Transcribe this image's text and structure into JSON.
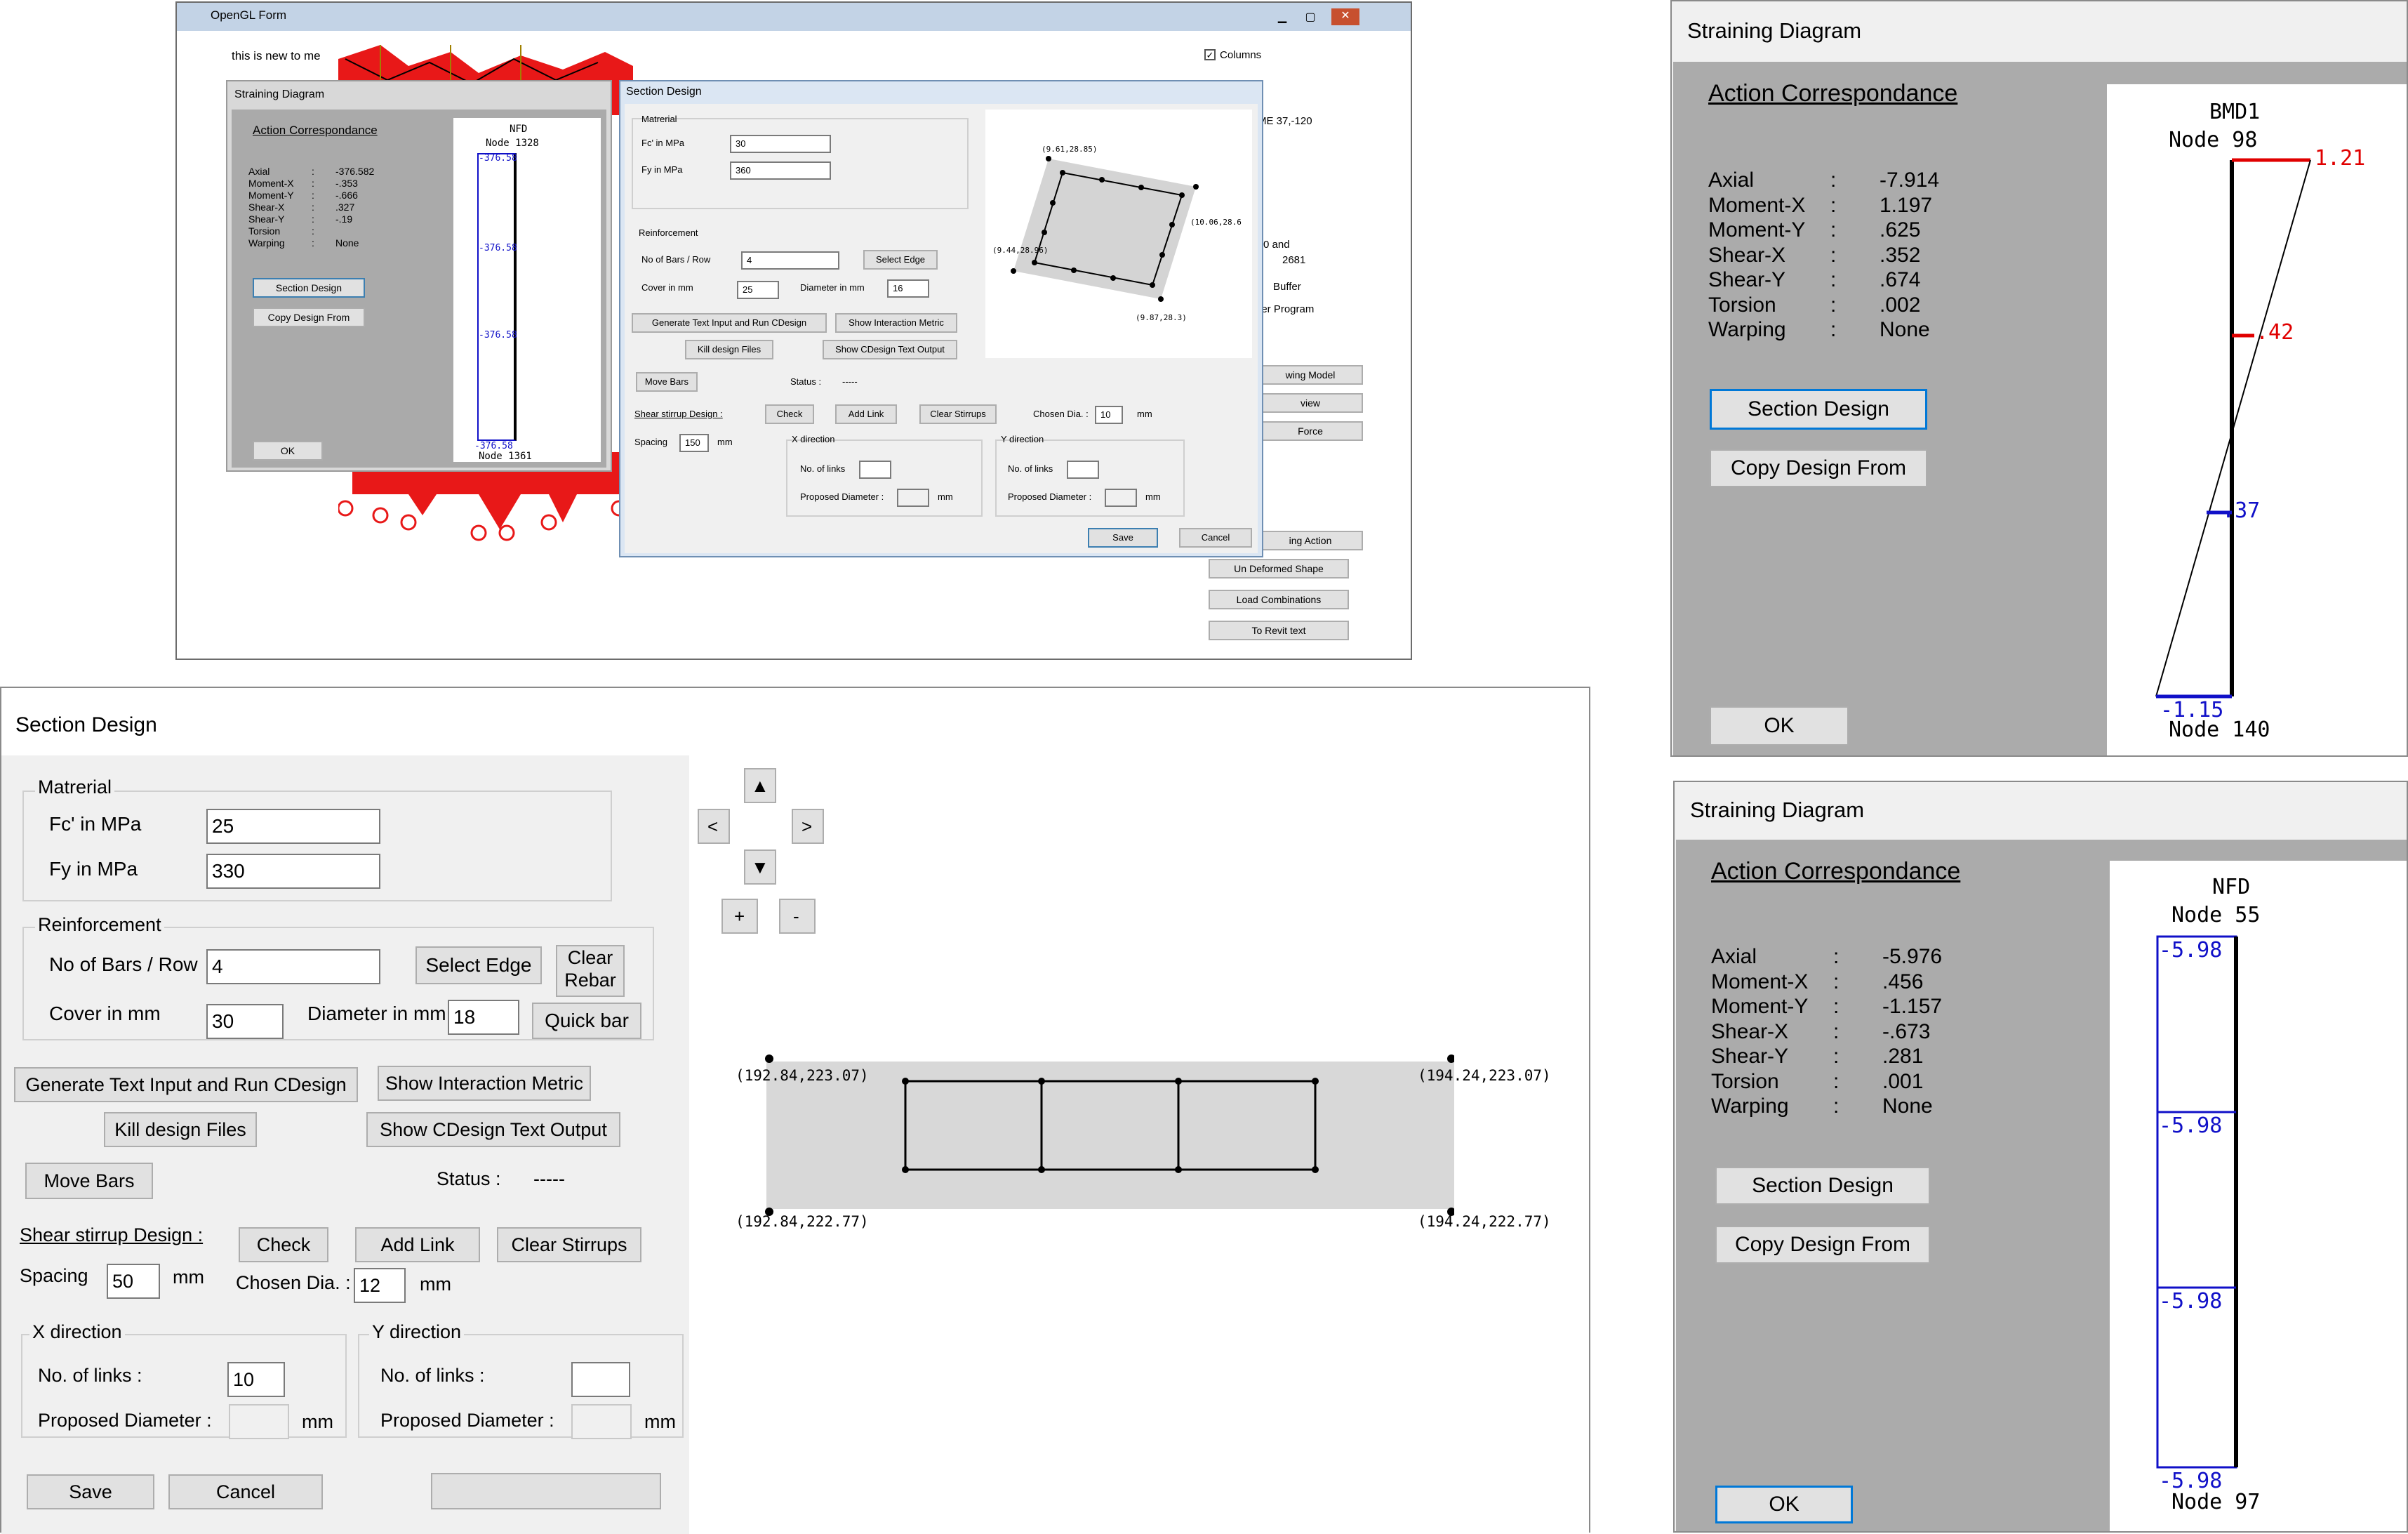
{
  "colors": {
    "dialog_bg": "#f0f0f0",
    "straining_bg": "#ababab",
    "moment_red": "#e00000",
    "value_blue": "#1010c8",
    "accent_blue": "#0078d7",
    "red_mesh": "#e81818"
  },
  "thumbnail": {
    "window_title": "OpenGL Form",
    "caption": "this is new to me",
    "min_icon": "minimize-icon",
    "max_icon": "maximize-icon",
    "close_icon": "close-icon",
    "columns_label": "Columns",
    "right_texts": [
      "ME 37,-120",
      "2681",
      "0 and",
      "Buffer",
      "ler Program"
    ],
    "right_buttons": [
      "wing Model",
      "view",
      "Force",
      "ing Action",
      "Un Deformed Shape",
      "Load Combinations",
      "To Revit text"
    ],
    "straining": {
      "title": "Straining Diagram",
      "action_title": "Action Correspondance",
      "rows": [
        {
          "k": "Axial",
          "v": "-376.582"
        },
        {
          "k": "Moment-X",
          "v": "-.353"
        },
        {
          "k": "Moment-Y",
          "v": "-.666"
        },
        {
          "k": "Shear-X",
          "v": ".327"
        },
        {
          "k": "Shear-Y",
          "v": "-.19"
        },
        {
          "k": "Torsion",
          "v": ""
        },
        {
          "k": "Warping",
          "v": "None"
        }
      ],
      "colon": ":",
      "section_design": "Section Design",
      "copy_design": "Copy Design From",
      "ok": "OK",
      "diagram_title": "NFD",
      "node_top": "Node 1328",
      "node_bottom": "Node 1361",
      "values": [
        "-376.58",
        "-376.58",
        "-376.58",
        "-376.58"
      ]
    },
    "section": {
      "title": "Section Design",
      "material": "Matrerial",
      "fc_label": "Fc' in MPa",
      "fc": "30",
      "fy_label": "Fy in MPa",
      "fy": "360",
      "reinforcement": "Reinforcement",
      "bars_label": "No of Bars / Row",
      "bars": "4",
      "select_edge": "Select Edge",
      "cover_label": "Cover in mm",
      "cover": "25",
      "dia_label": "Diameter in mm",
      "dia": "16",
      "gen": "Generate Text Input and Run CDesign",
      "show_im": "Show Interaction Metric",
      "kill": "Kill design Files",
      "show_out": "Show CDesign Text Output",
      "move": "Move Bars",
      "status_label": "Status :",
      "status": "-----",
      "shear": "Shear stirrup Design :",
      "check": "Check",
      "add_link": "Add Link",
      "clear_stir": "Clear Stirrups",
      "chosen_label": "Chosen Dia. :",
      "chosen": "10",
      "mm": "mm",
      "spacing_label": "Spacing",
      "spacing": "150",
      "xdir": "X direction",
      "ydir": "Y direction",
      "nlinks": "No. of links",
      "proposed": "Proposed Diameter :",
      "save": "Save",
      "cancel": "Cancel",
      "coords": [
        "(9.61,28.85)",
        "(10.06,28.6",
        "(9.44,28.96)",
        "(9.87,28.3)"
      ]
    }
  },
  "section_design": {
    "title": "Section Design",
    "material_group": "Matrerial",
    "fc_label": "Fc' in MPa",
    "fc_value": "25",
    "fy_label": "Fy in MPa",
    "fy_value": "330",
    "reinforcement_group": "Reinforcement",
    "bars_label": "No of Bars / Row",
    "bars_value": "4",
    "select_edge": "Select Edge",
    "clear_rebar_1": "Clear",
    "clear_rebar_2": "Rebar",
    "cover_label": "Cover in mm",
    "cover_value": "30",
    "diameter_label": "Diameter in mm",
    "diameter_value": "18",
    "quick_bar": "Quick bar",
    "generate": "Generate Text Input and Run CDesign",
    "show_interaction": "Show Interaction Metric",
    "kill_files": "Kill design Files",
    "show_output": "Show CDesign Text Output",
    "move_bars": "Move Bars",
    "status_label": "Status :",
    "status_value": "-----",
    "shear_label": "Shear stirrup Design :",
    "check": "Check",
    "add_link": "Add Link",
    "clear_stirrups": "Clear Stirrups",
    "spacing_label": "Spacing",
    "spacing_value": "50",
    "mm": "mm",
    "chosen_dia_label": "Chosen Dia. :",
    "chosen_dia_value": "12",
    "x_direction": "X direction",
    "y_direction": "Y direction",
    "no_links_label": "No. of links :",
    "x_links_value": "10",
    "y_links_value": "",
    "proposed_label": "Proposed Diameter :",
    "save": "Save",
    "cancel": "Cancel",
    "nav": {
      "up": "▲",
      "down": "▼",
      "left": "<",
      "right": ">",
      "plus": "+",
      "minus": "-"
    },
    "coords": {
      "tl": "(192.84,223.07)",
      "tr": "(194.24,223.07)",
      "bl": "(192.84,222.77)",
      "br": "(194.24,222.77)"
    }
  },
  "straining_bmd": {
    "title": "Straining Diagram",
    "action_title": "Action Correspondance",
    "colon": ":",
    "rows": [
      {
        "k": "Axial",
        "v": "-7.914"
      },
      {
        "k": "Moment-X",
        "v": "1.197"
      },
      {
        "k": "Moment-Y",
        "v": ".625"
      },
      {
        "k": "Shear-X",
        "v": ".352"
      },
      {
        "k": "Shear-Y",
        "v": ".674"
      },
      {
        "k": "Torsion",
        "v": ".002"
      },
      {
        "k": "Warping",
        "v": "None"
      }
    ],
    "section_design": "Section Design",
    "copy_design": "Copy Design From",
    "ok": "OK",
    "diagram_title": "BMD1",
    "node_top": "Node 98",
    "node_bottom": "Node 140",
    "v1": "1.21",
    "v2": ".42",
    "v3": "-.37",
    "v4": "-1.15"
  },
  "straining_nfd": {
    "title": "Straining Diagram",
    "action_title": "Action Correspondance",
    "colon": ":",
    "rows": [
      {
        "k": "Axial",
        "v": "-5.976"
      },
      {
        "k": "Moment-X",
        "v": ".456"
      },
      {
        "k": "Moment-Y",
        "v": "-1.157"
      },
      {
        "k": "Shear-X",
        "v": "-.673"
      },
      {
        "k": "Shear-Y",
        "v": ".281"
      },
      {
        "k": "Torsion",
        "v": ".001"
      },
      {
        "k": "Warping",
        "v": "None"
      }
    ],
    "section_design": "Section Design",
    "copy_design": "Copy Design From",
    "ok": "OK",
    "diagram_title": "NFD",
    "node_top": "Node 55",
    "node_bottom": "Node 97",
    "values": [
      "-5.98",
      "-5.98",
      "-5.98",
      "-5.98"
    ]
  }
}
